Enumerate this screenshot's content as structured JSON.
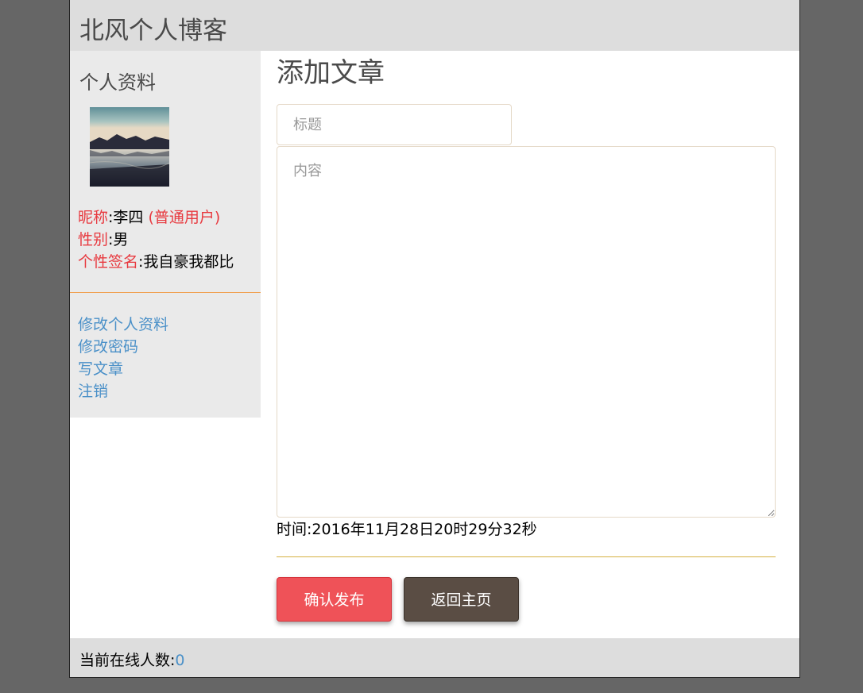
{
  "header": {
    "site_title": "北风个人博客"
  },
  "sidebar": {
    "heading": "个人资料",
    "profile": {
      "nickname_label": "昵称",
      "nickname_value": "李四",
      "role": "(普通用户)",
      "gender_label": "性别",
      "gender_value": "男",
      "signature_label": "个性签名",
      "signature_value": "我自豪我都比"
    },
    "links": [
      {
        "label": "修改个人资料"
      },
      {
        "label": "修改密码"
      },
      {
        "label": "写文章"
      },
      {
        "label": "注销"
      }
    ]
  },
  "main": {
    "heading": "添加文章",
    "title_field": {
      "placeholder": "标题",
      "value": ""
    },
    "content_field": {
      "placeholder": "内容",
      "value": ""
    },
    "time_label": "时间",
    "time_value": "2016年11月28日20时29分32秒",
    "buttons": {
      "publish": "确认发布",
      "home": "返回主页"
    }
  },
  "footer": {
    "online_label": "当前在线人数",
    "online_count": "0"
  },
  "colors": {
    "background": "#666666",
    "header_bg": "#dddddd",
    "sidebar_bg": "#eaeaea",
    "label_red": "#e8393f",
    "link_blue": "#4a90c8",
    "publish_button": "#ef5258",
    "home_button": "#5a4d44",
    "orange_divider": "#f0a050",
    "gold_divider": "#d4b040"
  }
}
